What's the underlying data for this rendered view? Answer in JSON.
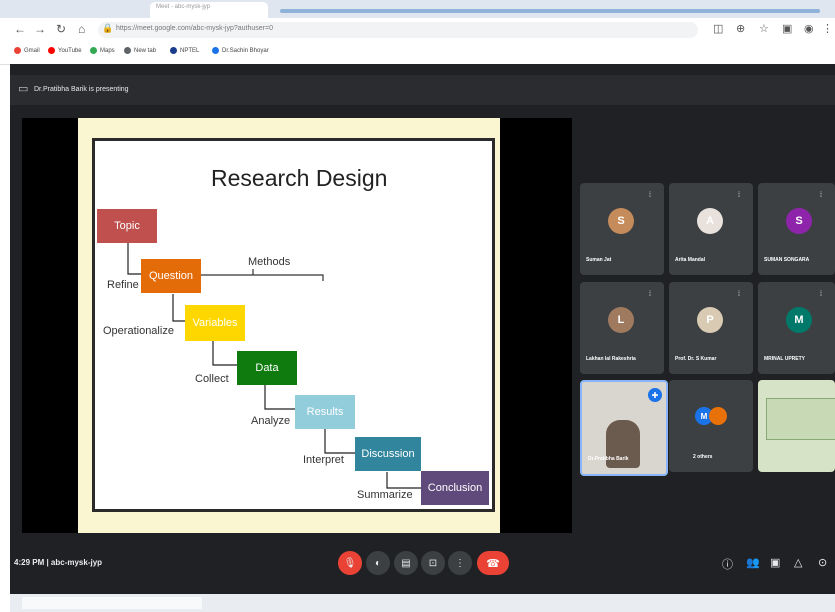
{
  "browser": {
    "tab_title": "Meet - abc-mysk-jyp",
    "address": "https://meet.google.com/abc-mysk-jyp?authuser=0",
    "bookmarks": [
      {
        "label": "Gmail",
        "color": "#ea4335"
      },
      {
        "label": "YouTube",
        "color": "#ff0000"
      },
      {
        "label": "Maps",
        "color": "#34a853"
      },
      {
        "label": "New tab",
        "color": "#5f6368"
      },
      {
        "label": "NPTEL",
        "color": "#1a3c8c"
      },
      {
        "label": "Dr.Sachin Bhoyar",
        "color": "#1a73e8"
      }
    ]
  },
  "meet": {
    "presenting_text": "Dr.Pratibha Barik is presenting",
    "meeting_time": "4:29 PM",
    "meeting_code": "abc-mysk-jyp",
    "participants": [
      {
        "name": "Suman Jat",
        "initial": "S",
        "avatar_color": "#c58b5a"
      },
      {
        "name": "Arita Mandal",
        "initial": "A",
        "avatar_color": "#e8e1dc"
      },
      {
        "name": "SUMAN SONGARA",
        "initial": "S",
        "avatar_color": "#8e24aa"
      },
      {
        "name": "Lakhan lal Rakeshria",
        "initial": "L",
        "avatar_color": "#a07a5e"
      },
      {
        "name": "Prof. Dr. S Kumar",
        "initial": "P",
        "avatar_color": "#d9cbb3"
      },
      {
        "name": "MRINAL UPRETY",
        "initial": "M",
        "avatar_color": "#00796b"
      },
      {
        "name": "Dr.Pratibha Barik",
        "initial": "",
        "avatar_color": ""
      },
      {
        "name": "2 others",
        "initial": "M",
        "avatar_color": "#1a73e8"
      }
    ],
    "accent_red": "#ea4335"
  },
  "slide": {
    "title": "Research Design",
    "methods_label": "Methods",
    "boxes": [
      {
        "label": "Topic",
        "color": "#c0504d"
      },
      {
        "label": "Question",
        "color": "#e36c09"
      },
      {
        "label": "Variables",
        "color": "#ffd700"
      },
      {
        "label": "Data",
        "color": "#0f7b0f"
      },
      {
        "label": "Results",
        "color": "#92cddc"
      },
      {
        "label": "Discussion",
        "color": "#31859c"
      },
      {
        "label": "Conclusion",
        "color": "#604a7b"
      }
    ],
    "step_labels": [
      "Refine",
      "Operationalize",
      "Collect",
      "Analyze",
      "Interpret",
      "Summarize"
    ]
  }
}
